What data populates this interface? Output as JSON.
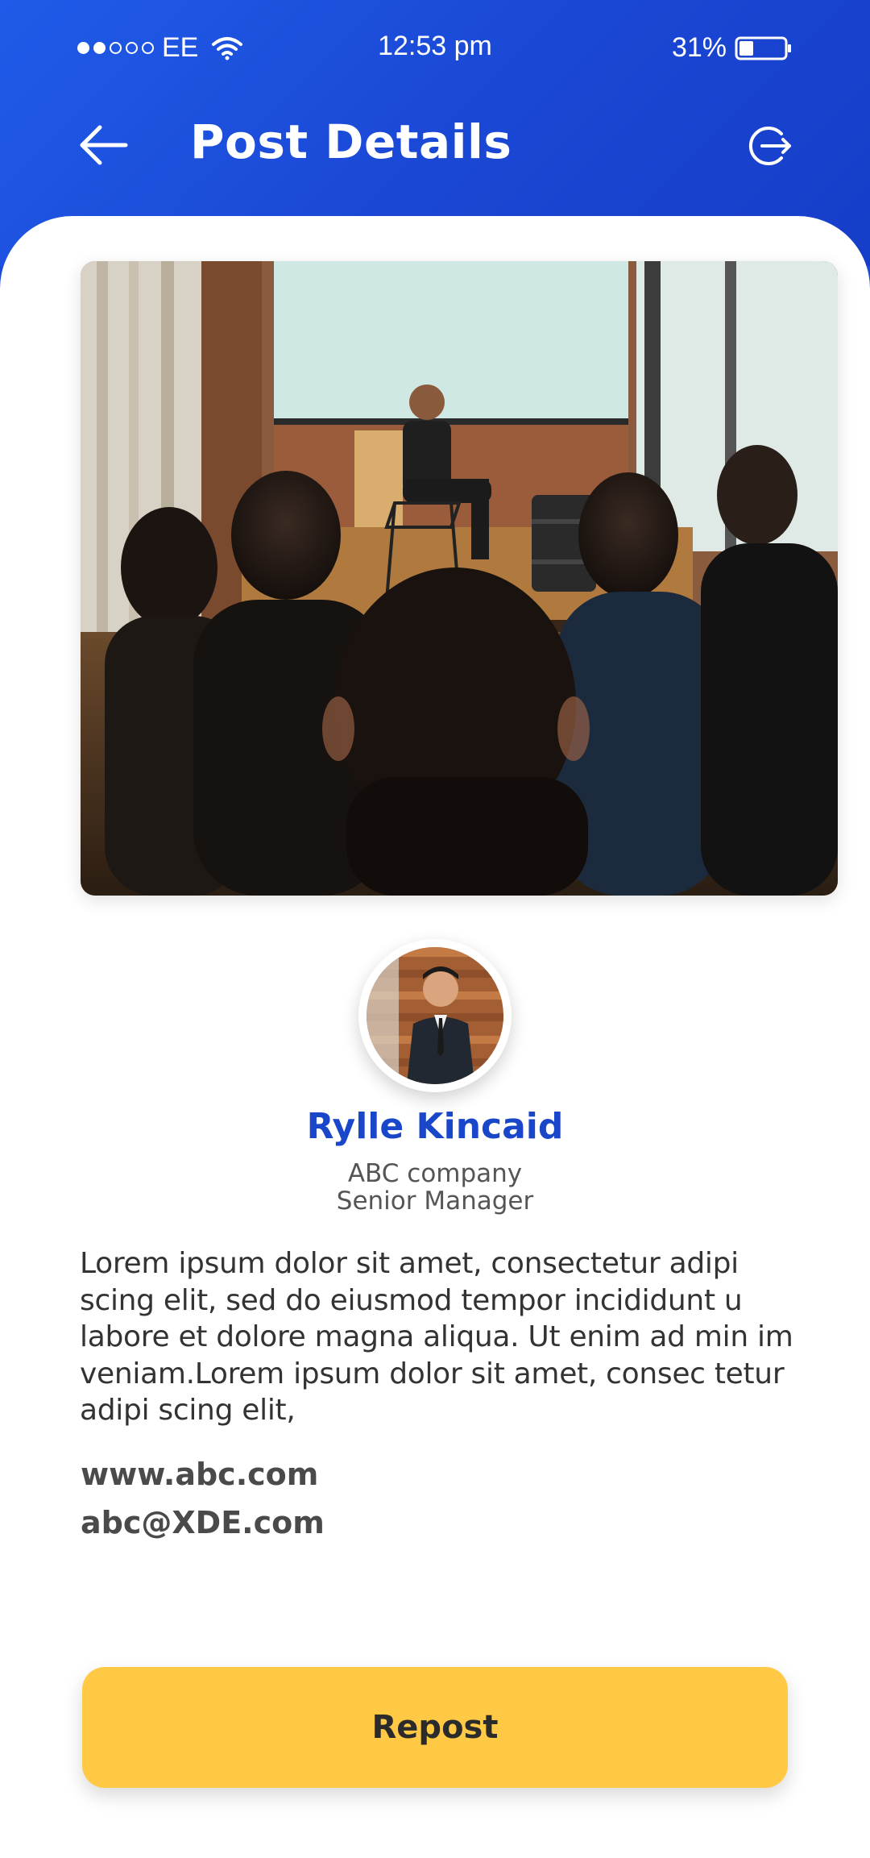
{
  "status_bar": {
    "carrier": "EE",
    "time": "12:53 pm",
    "battery": "31%"
  },
  "header": {
    "title": "Post Details",
    "back_icon": "arrow-left-icon",
    "action_icon": "logout-icon"
  },
  "post": {
    "image_alt": "speaker-presentation-photo",
    "battery_level": 0.31
  },
  "profile": {
    "name": "Rylle Kincaid",
    "company": "ABC company",
    "role": "Senior Manager",
    "avatar_icon": "avatar-photo"
  },
  "description": "Lorem ipsum dolor sit amet, consectetur adipi scing elit, sed do eiusmod tempor incididunt u labore et dolore magna aliqua. Ut enim ad min im veniam.Lorem ipsum dolor sit amet, consec tetur adipi scing elit,",
  "contact": {
    "website": "www.abc.com",
    "email": "abc@XDE.com"
  },
  "actions": {
    "repost_label": "Repost"
  },
  "colors": {
    "header_blue": "#1a47d4",
    "name_blue": "#1a47c9",
    "button_yellow": "#ffc845",
    "text_dark": "#333333"
  }
}
